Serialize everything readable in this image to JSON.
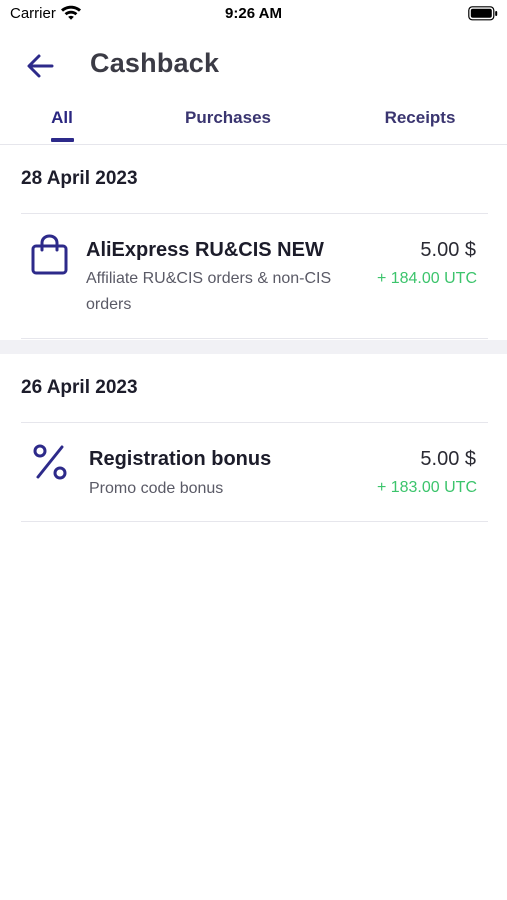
{
  "status_bar": {
    "carrier": "Carrier",
    "time": "9:26 AM"
  },
  "header": {
    "title": "Cashback",
    "back_icon": "arrow-left-icon"
  },
  "tabs": [
    {
      "label": "All",
      "active": true
    },
    {
      "label": "Purchases",
      "active": false
    },
    {
      "label": "Receipts",
      "active": false
    }
  ],
  "sections": [
    {
      "date": "28 April 2023",
      "items": [
        {
          "icon": "shopping-bag-icon",
          "title": "AliExpress RU&CIS NEW",
          "subtitle": "Affiliate RU&CIS orders & non-CIS orders",
          "amount": "5.00 $",
          "utc": "+ 184.00 UTC"
        }
      ]
    },
    {
      "date": "26 April 2023",
      "items": [
        {
          "icon": "percent-icon",
          "title": "Registration bonus",
          "subtitle": "Promo code bonus",
          "amount": "5.00 $",
          "utc": "+ 183.00 UTC"
        }
      ]
    }
  ],
  "colors": {
    "accent": "#2d2a8a",
    "positive": "#3cc46c"
  }
}
